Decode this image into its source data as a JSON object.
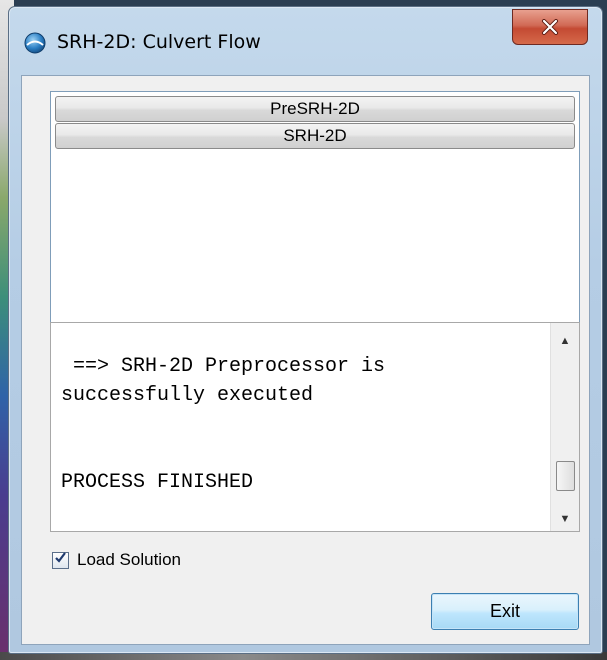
{
  "window": {
    "title": "SRH-2D: Culvert Flow",
    "icon": "globe-app-icon",
    "close_icon": "close-x-icon"
  },
  "list": {
    "items": [
      {
        "label": "PreSRH-2D"
      },
      {
        "label": "SRH-2D"
      }
    ]
  },
  "log": {
    "lines": [
      "",
      " ==> SRH-2D Preprocessor is",
      "successfully executed",
      "",
      "",
      "PROCESS FINISHED"
    ]
  },
  "scrollbar": {
    "up_icon": "arrow-up-icon",
    "down_icon": "arrow-down-icon"
  },
  "options": {
    "load_solution_label": "Load Solution",
    "load_solution_checked": true
  },
  "buttons": {
    "exit_label": "Exit"
  },
  "colors": {
    "close_button": "#c44a33",
    "exit_button_border": "#3c7fb1",
    "title_bar": "#b5cde5"
  }
}
